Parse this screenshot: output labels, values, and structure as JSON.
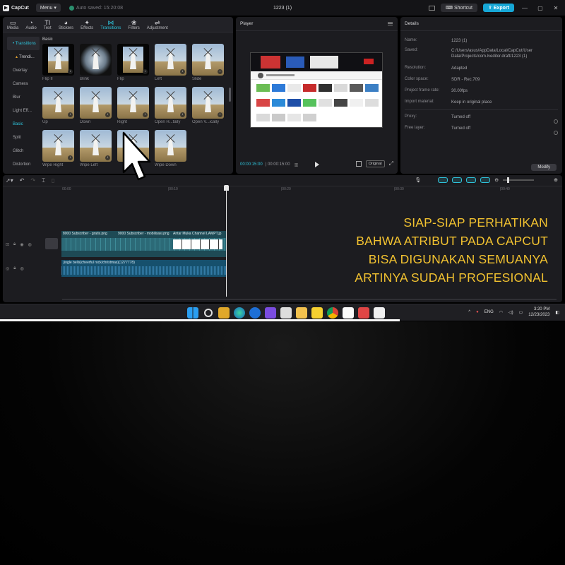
{
  "titlebar": {
    "app_name": "CapCut",
    "menu_label": "Menu",
    "autosave": "Auto saved: 15:20:08",
    "project_title": "1223 (1)",
    "shortcut_label": "Shortcut",
    "export_label": "Export"
  },
  "toolbar": {
    "items": [
      {
        "label": "Media",
        "icon": "media-icon"
      },
      {
        "label": "Audio",
        "icon": "audio-icon"
      },
      {
        "label": "Text",
        "icon": "text-icon"
      },
      {
        "label": "Stickers",
        "icon": "stickers-icon"
      },
      {
        "label": "Effects",
        "icon": "effects-icon"
      },
      {
        "label": "Transitions",
        "icon": "transitions-icon"
      },
      {
        "label": "Filters",
        "icon": "filters-icon"
      },
      {
        "label": "Adjustment",
        "icon": "adjustment-icon"
      }
    ]
  },
  "sidebar": {
    "header": "• Transitions",
    "items": [
      "Trendi...",
      "Overlay",
      "Camera",
      "Blur",
      "Light Eff...",
      "Basic",
      "Split",
      "Glitch",
      "Distortion"
    ],
    "selected": "Basic"
  },
  "grid": {
    "section_label": "Basic",
    "tiles": [
      "Flip II",
      "Blink",
      "Flip",
      "Left",
      "Slide",
      "Up",
      "Down",
      "Right",
      "Open H...tally",
      "Open V...ically",
      "Wipe Right",
      "Wipe Left",
      "",
      "Wipe Down"
    ]
  },
  "player": {
    "title": "Player",
    "current_time": "00:00:15:00",
    "duration": "00:00:15:00",
    "original_label": "Original"
  },
  "details": {
    "title": "Details",
    "rows": [
      {
        "key": "Name:",
        "value": "1223 (1)"
      },
      {
        "key": "Saved:",
        "value": "C:/Users/asus/AppData/Local/CapCut/User Data/Projects/com.lveditor.draft/1223 (1)"
      },
      {
        "key": "Resolution:",
        "value": "Adapted"
      },
      {
        "key": "Color space:",
        "value": "SDR - Rec.709"
      },
      {
        "key": "Project frame rate:",
        "value": "30.00fps"
      },
      {
        "key": "Import material:",
        "value": "Keep in original place"
      }
    ],
    "rows2": [
      {
        "key": "Proxy:",
        "value": "Turned off"
      },
      {
        "key": "Free layer:",
        "value": "Turned off"
      }
    ],
    "modify_label": "Modify"
  },
  "timeline": {
    "ruler": [
      "00:00",
      "|00:10",
      "|00:20",
      "|00:30",
      "|00:40"
    ],
    "clip_labels": [
      "8000 Subscriber - gratis.png",
      "9000 Subscriber - mobilisasi.png",
      "Antar Muka Channel LAMPT.jp"
    ],
    "audio_label": "jingle bells(cheerful rock/christmas)(1277778)"
  },
  "caption": {
    "lines": [
      "SIAP-SIAP PERHATIKAN",
      "BAHWA ATRIBUT PADA CAPCUT",
      "BISA DIGUNAKAN SEMUANYA",
      "ARTINYA SUDAH PROFESIONAL"
    ],
    "color": "#f2c230"
  },
  "taskbar": {
    "lang": "ENG",
    "time": "3:20 PM",
    "date": "12/23/2023"
  }
}
